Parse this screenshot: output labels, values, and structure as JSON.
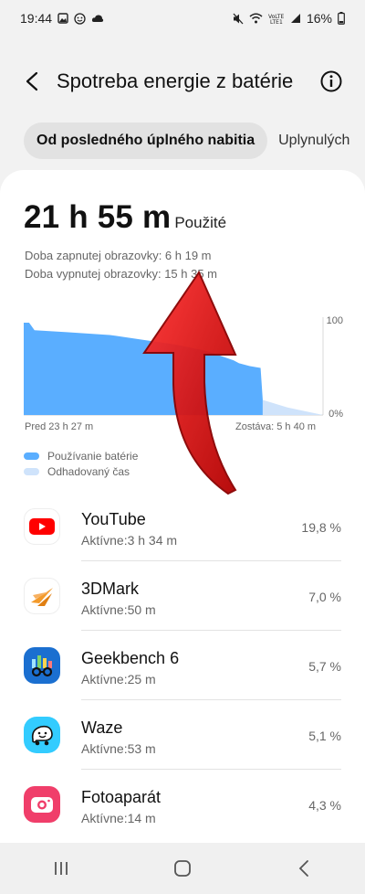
{
  "status_bar": {
    "time": "19:44",
    "battery": "16%",
    "left_icons": [
      "gallery-icon",
      "emoji-icon",
      "cloud-icon"
    ],
    "right_icons": [
      "mute-icon",
      "wifi-icon",
      "volte-icon",
      "signal-icon",
      "battery-icon"
    ]
  },
  "header": {
    "title": "Spotreba energie z batérie"
  },
  "tabs": [
    {
      "label": "Od posledného úplného nabitia",
      "active": true
    },
    {
      "label": "Uplynulých",
      "active": false
    }
  ],
  "summary": {
    "usage_value": "21 h 55 m",
    "usage_label": "Použité",
    "screen_on": "Doba zapnutej obrazovky: 6 h 19 m",
    "screen_off": "Doba vypnutej obrazovky: 15 h 35 m"
  },
  "chart": {
    "tick_top": "100",
    "tick_bottom": "0%",
    "left_label": "Pred 23 h 27 m",
    "right_label": "Zostáva: 5 h 40 m",
    "used_color": "#5aaeff",
    "estimate_color": "#cfe3fb"
  },
  "chart_data": {
    "type": "area",
    "ylim": [
      0,
      100
    ],
    "series": [
      {
        "name": "Používanie batérie",
        "x": [
          0,
          0.5,
          1,
          4,
          8,
          11,
          14,
          17,
          19.5,
          20,
          21,
          22,
          22.2
        ],
        "values": [
          98,
          98,
          90,
          88,
          85,
          80,
          75,
          68,
          58,
          55,
          52,
          50,
          16
        ]
      },
      {
        "name": "Odhadovaný čas",
        "x": [
          22.2,
          24.5,
          27.8
        ],
        "values": [
          16,
          8,
          0
        ]
      }
    ]
  },
  "legend": {
    "used": "Používanie batérie",
    "estimated": "Odhadovaný čas"
  },
  "apps": [
    {
      "name": "YouTube",
      "active": "Aktívne:3 h 34 m",
      "percent": "19,8 %",
      "icon": "youtube-icon"
    },
    {
      "name": "3DMark",
      "active": "Aktívne:50 m",
      "percent": "7,0 %",
      "icon": "3dmark-icon"
    },
    {
      "name": "Geekbench 6",
      "active": "Aktívne:25 m",
      "percent": "5,7 %",
      "icon": "geekbench-icon"
    },
    {
      "name": "Waze",
      "active": "Aktívne:53 m",
      "percent": "5,1 %",
      "icon": "waze-icon"
    },
    {
      "name": "Fotoaparát",
      "active": "Aktívne:14 m",
      "percent": "4,3 %",
      "icon": "camera-icon"
    }
  ],
  "nav": {
    "icons": [
      "recents-icon",
      "home-icon",
      "back-icon"
    ]
  }
}
